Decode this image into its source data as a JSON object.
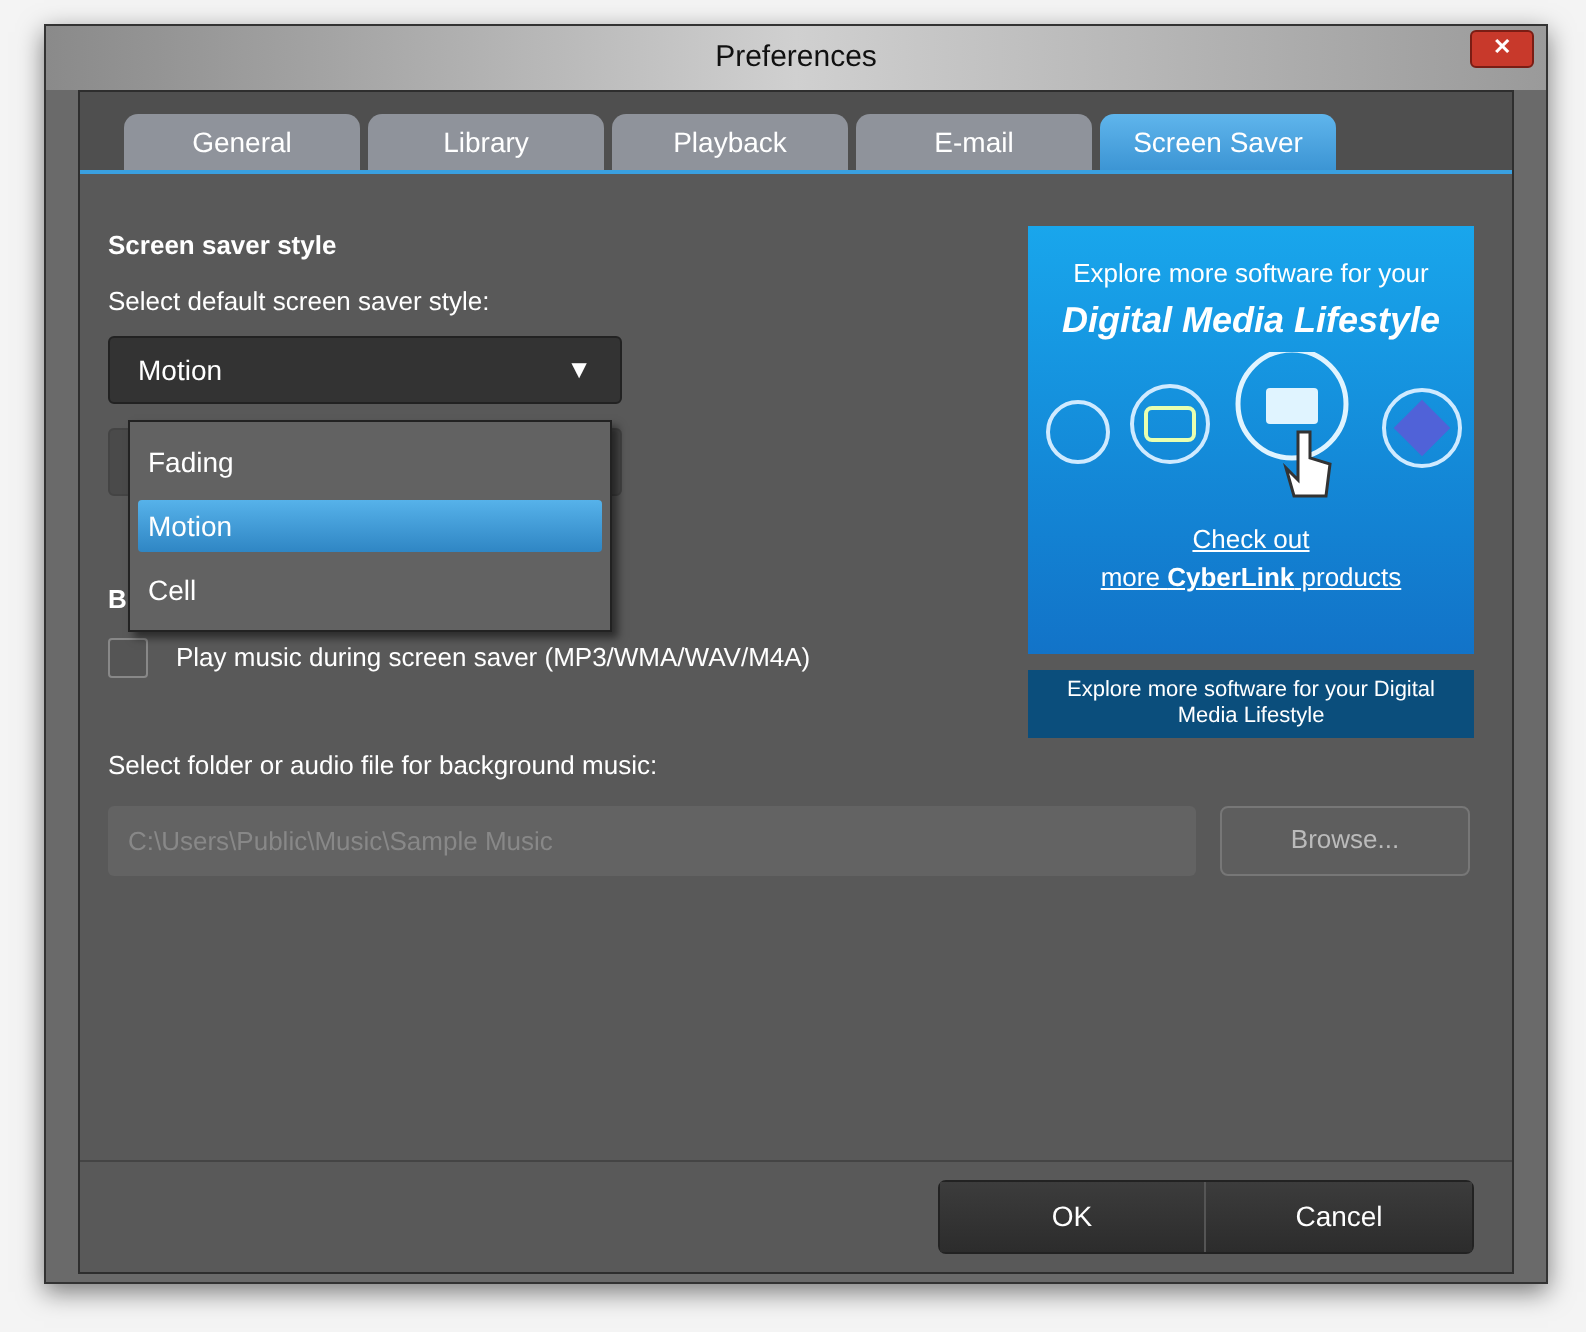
{
  "window": {
    "title": "Preferences",
    "close": "✕"
  },
  "tabs": [
    {
      "label": "General",
      "selected": false
    },
    {
      "label": "Library",
      "selected": false
    },
    {
      "label": "Playback",
      "selected": false
    },
    {
      "label": "E-mail",
      "selected": false
    },
    {
      "label": "Screen Saver",
      "selected": true
    }
  ],
  "style_section": {
    "heading": "Screen saver style",
    "label": "Select default screen saver style:",
    "value": "Motion",
    "arrow": "▼",
    "options": [
      {
        "label": "Fading",
        "selected": false
      },
      {
        "label": "Motion",
        "selected": true
      },
      {
        "label": "Cell",
        "selected": false
      }
    ]
  },
  "music_section": {
    "heading": "B",
    "checkbox": {
      "label": "Play music during screen saver (MP3/WMA/WAV/M4A)",
      "checked": false
    },
    "folder_label": "Select folder or audio file for background music:",
    "folder_value": "C:\\Users\\Public\\Music\\Sample Music",
    "browse": "Browse..."
  },
  "ad": {
    "headline": "Explore more software for your",
    "headline_big": "Digital Media Lifestyle",
    "link_line_1": "Check out",
    "link_line_2": "more **CyberLink** products",
    "caption": "Explore more software for your Digital Media Lifestyle"
  },
  "buttons": [
    "OK",
    "Cancel"
  ]
}
